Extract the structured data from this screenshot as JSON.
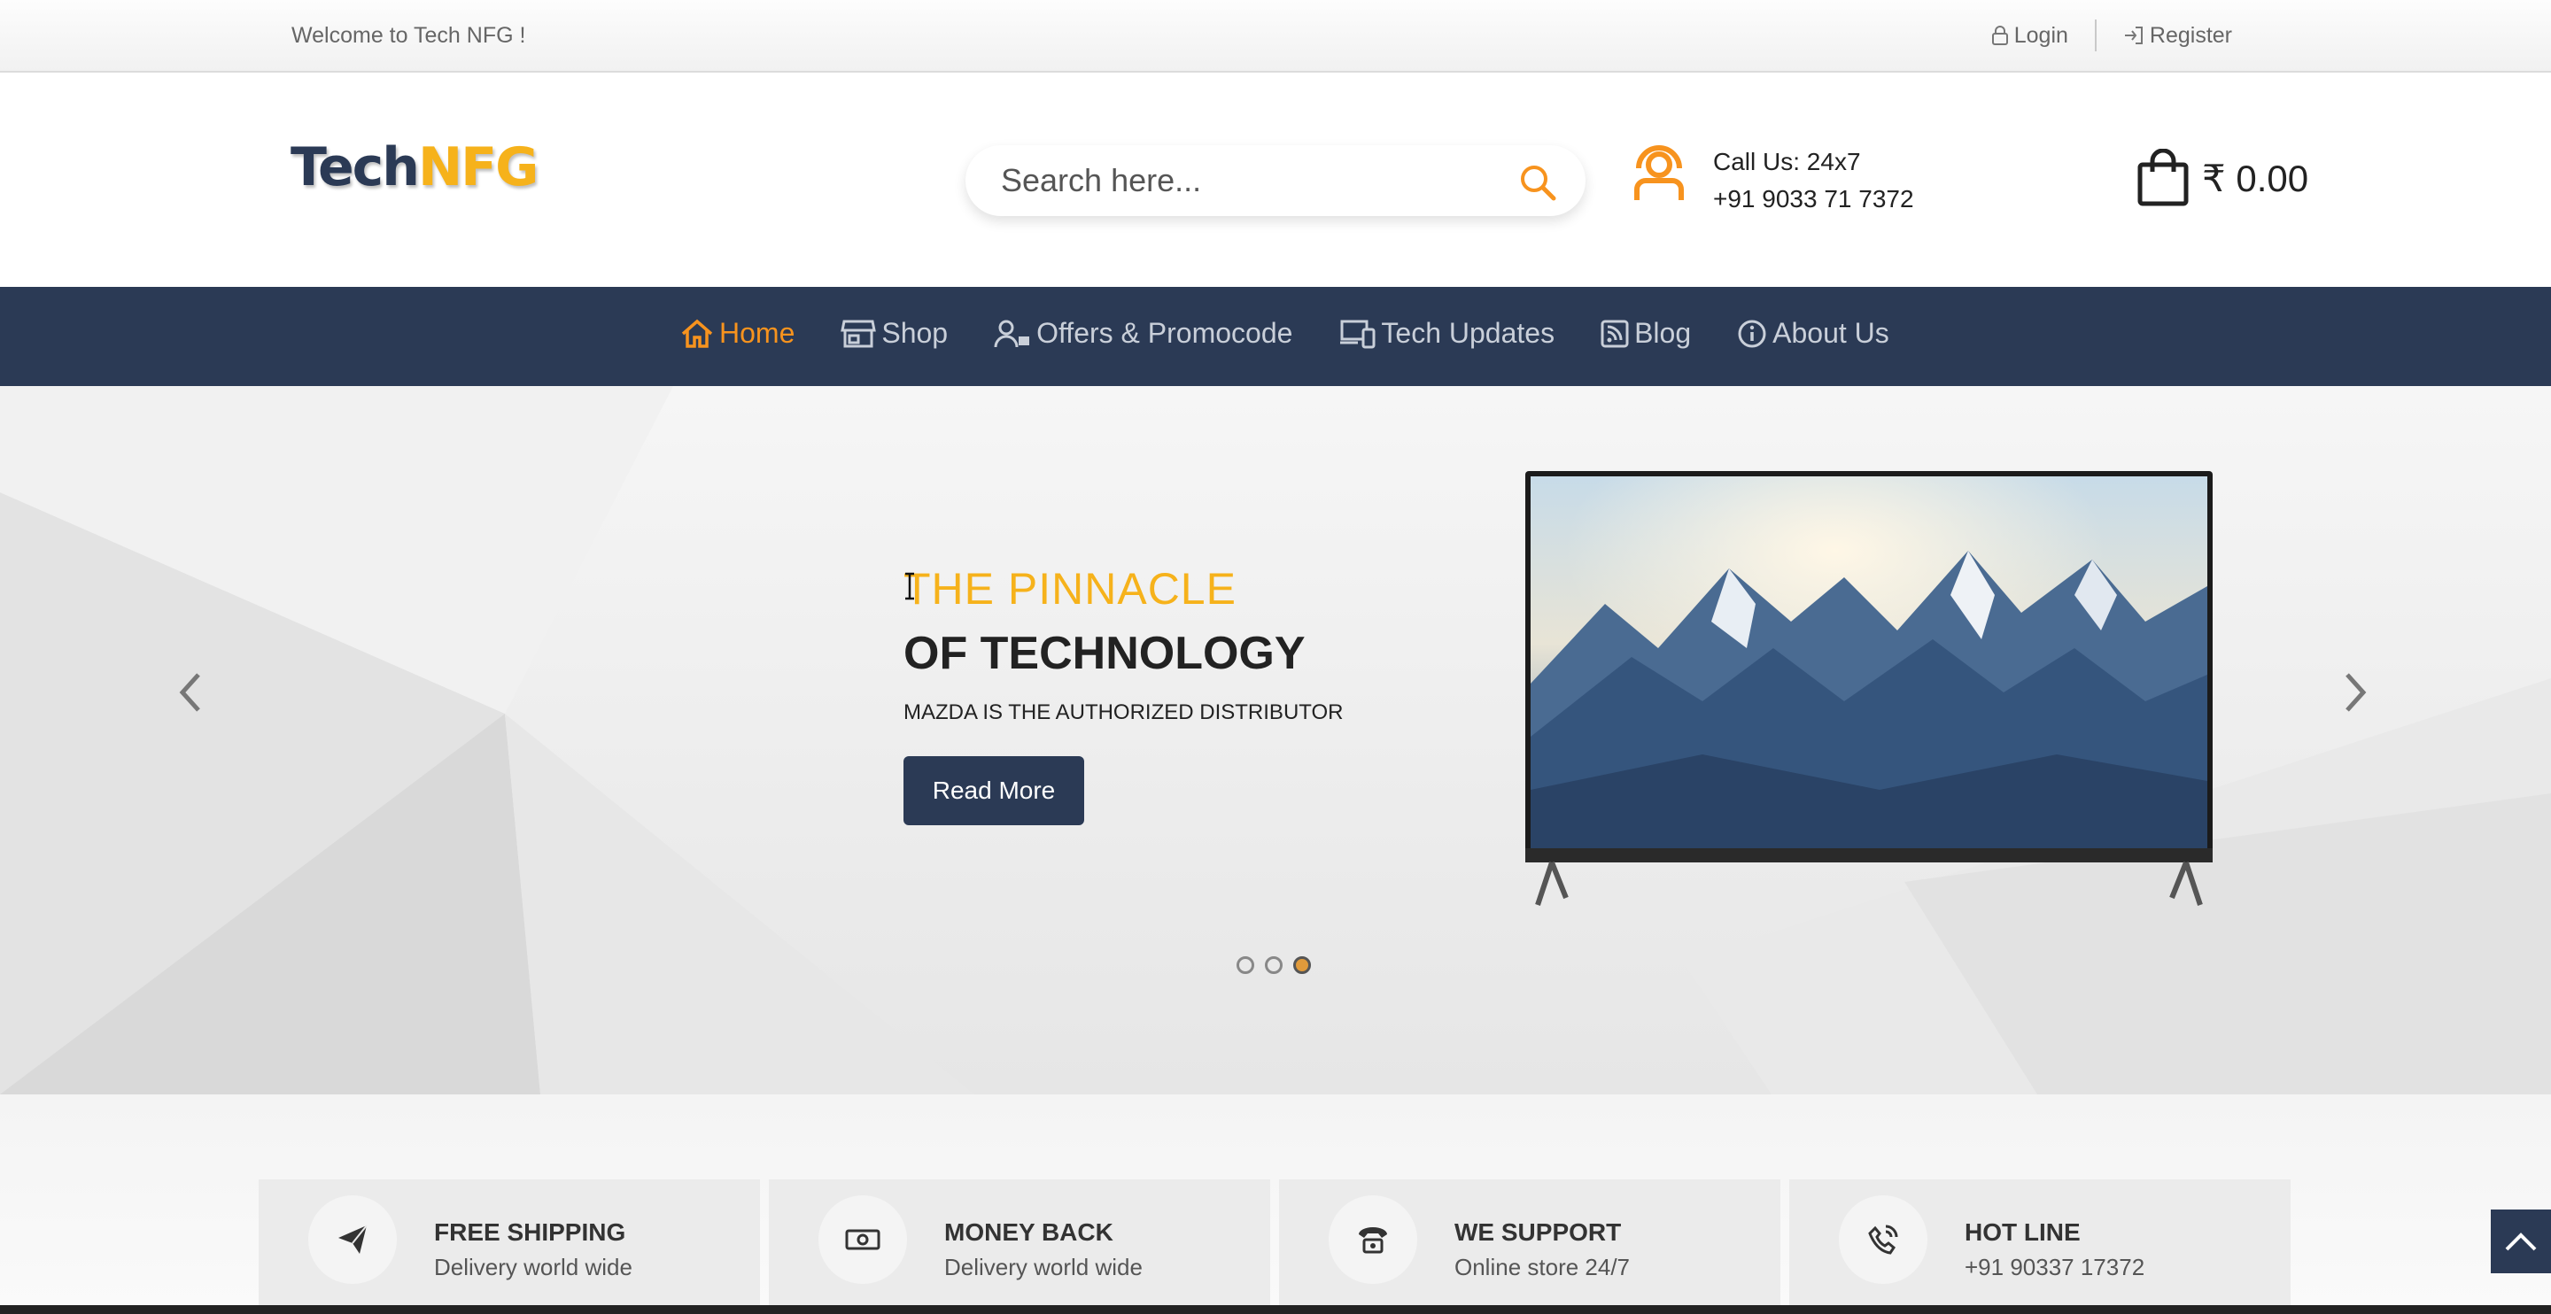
{
  "topbar": {
    "welcome": "Welcome to Tech NFG !",
    "login": "Login",
    "register": "Register"
  },
  "header": {
    "logo_part1": "Tech",
    "logo_part2": "NFG",
    "search_placeholder": "Search here...",
    "call_line1": "Call Us: 24x7",
    "call_line2": "+91 9033 71 7372",
    "cart_currency": "₹",
    "cart_amount": "0.00"
  },
  "nav": {
    "items": [
      {
        "label": "Home",
        "icon": "home-icon",
        "active": true
      },
      {
        "label": "Shop",
        "icon": "shop-icon",
        "active": false
      },
      {
        "label": "Offers & Promocode",
        "icon": "user-tag-icon",
        "active": false
      },
      {
        "label": "Tech Updates",
        "icon": "devices-icon",
        "active": false
      },
      {
        "label": "Blog",
        "icon": "rss-icon",
        "active": false
      },
      {
        "label": "About Us",
        "icon": "info-icon",
        "active": false
      }
    ]
  },
  "hero": {
    "subtitle": "THE PINNACLE",
    "title": "OF TECHNOLOGY",
    "description": "MAZDA IS THE AUTHORIZED DISTRIBUTOR",
    "button": "Read More",
    "slides": 3,
    "active_slide": 3
  },
  "features": [
    {
      "title": "FREE SHIPPING",
      "subtitle": "Delivery world wide",
      "icon": "paper-plane-icon"
    },
    {
      "title": "MONEY BACK",
      "subtitle": "Delivery world wide",
      "icon": "money-icon"
    },
    {
      "title": "WE SUPPORT",
      "subtitle": "Online store 24/7",
      "icon": "phone-icon"
    },
    {
      "title": "HOT LINE",
      "subtitle": "+91 90337 17372",
      "icon": "phone-call-icon"
    }
  ],
  "colors": {
    "navy": "#2b3a55",
    "accent_orange": "#f7931e",
    "accent_yellow": "#f6b21b"
  }
}
